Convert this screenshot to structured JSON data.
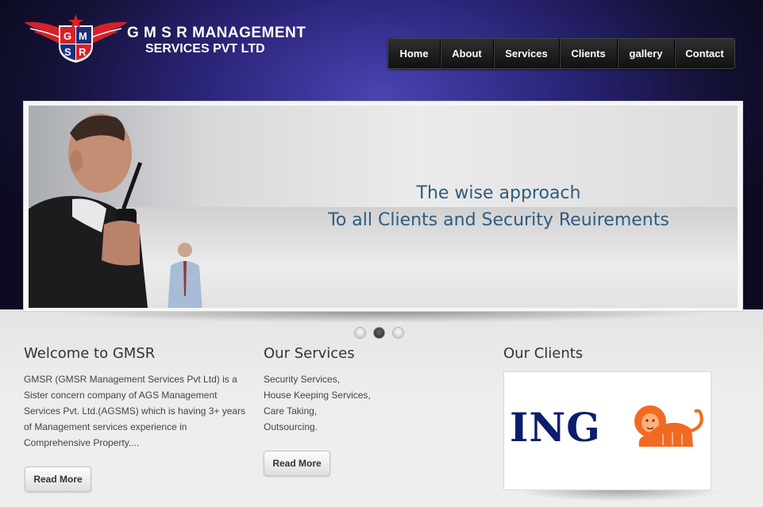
{
  "brand": {
    "logo_letters": [
      "G",
      "M",
      "S",
      "R"
    ],
    "name_line1": "G M S R MANAGEMENT",
    "name_line2": "SERVICES PVT LTD"
  },
  "nav": {
    "items": [
      "Home",
      "About",
      "Services",
      "Clients",
      "gallery",
      "Contact"
    ]
  },
  "slider": {
    "line1": "The wise approach",
    "line2": "To all Clients and Security Reuirements",
    "dots": 3,
    "active_dot": 2
  },
  "welcome": {
    "title": "Welcome to GMSR",
    "text": "GMSR (GMSR Management Services Pvt Ltd) is a Sister concern company of AGS Management Services Pvt. Ltd.(AGSMS) which is having 3+ years of Management services experience in Comprehensive Property....",
    "button": "Read More"
  },
  "services": {
    "title": "Our Services",
    "items": [
      "Security Services,",
      "House Keeping Services,",
      "Care Taking,",
      "Outsourcing."
    ],
    "button": "Read More"
  },
  "clients": {
    "title": "Our Clients",
    "logo_text": "ING"
  },
  "colors": {
    "header_bg": "#2a2477",
    "slide_text": "#2e5c80",
    "ing_blue": "#0c1d6c",
    "ing_orange": "#f26a21",
    "logo_red": "#d7202a",
    "logo_blue": "#1c2f7a"
  }
}
